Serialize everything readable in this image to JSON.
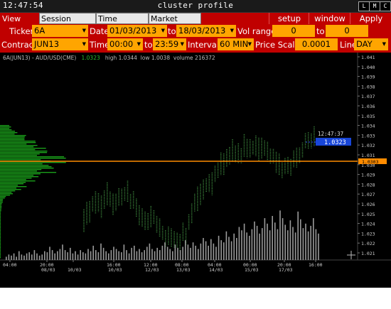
{
  "window": {
    "clock": "12:47:54",
    "title": "cluster profile",
    "buttons": [
      "L",
      "M",
      "C"
    ]
  },
  "menu": {
    "tabs": [
      "View DOM",
      "Session Hours",
      "Time Interval",
      "Market Watch"
    ],
    "active_tab": "View DOM",
    "right_buttons": [
      "setup",
      "window",
      "Apply"
    ]
  },
  "params": {
    "ticker_label": "Ticker",
    "ticker": "6A",
    "date_label": "Date",
    "date_from": "01/03/2013",
    "date_to_label": "to",
    "date_to": "18/03/2013",
    "vol_range_label": "Vol range",
    "vol_from": "0",
    "vol_to_label": "to",
    "vol_to": "0",
    "contract_label": "Contract",
    "contract": "JUN13",
    "time_label": "Time",
    "time_from": "00:00",
    "time_to_label": "to",
    "time_to": "23:59",
    "interval_label": "Interval",
    "interval": "60 MIN",
    "price_scale_label": "Price Scale",
    "price_scale": "0.0001",
    "line_label": "Line",
    "line": "DAY"
  },
  "chart": {
    "symbol": "6A(JUN13) - AUD/USD(CME)",
    "last": "1.0323",
    "high_text": "high 1.0344",
    "low_text": "low 1.0038",
    "volume_text": "volume 216372",
    "cursor_time": "12:47:37",
    "cursor_price": "1.0323",
    "line_price": "1.0303",
    "colors": {
      "grid": "#2a2a2a",
      "candles": "#3e8a3e",
      "profile": "#1a9e1a",
      "volume": "#9a9a9a",
      "line": "#ff8c00",
      "price_tag": "#1846d8"
    }
  },
  "chart_data": {
    "type": "bar",
    "y_ticks": [
      "1.041",
      "1.040",
      "1.039",
      "1.038",
      "1.037",
      "1.036",
      "1.035",
      "1.034",
      "1.033",
      "1.032",
      "1.031",
      "1.030",
      "1.029",
      "1.028",
      "1.027",
      "1.026",
      "1.025",
      "1.024",
      "1.023",
      "1.022",
      "1.021"
    ],
    "x_ticks": [
      {
        "time": "04:00",
        "date": ""
      },
      {
        "time": "20:00",
        "date": "08/03"
      },
      {
        "time": "",
        "date": "10/03"
      },
      {
        "time": "16:00",
        "date": "10/03"
      },
      {
        "time": "12:00",
        "date": "12/03"
      },
      {
        "time": "08:00",
        "date": "13/03"
      },
      {
        "time": "04:00",
        "date": "14/03"
      },
      {
        "time": "00:00",
        "date": "15/03"
      },
      {
        "time": "20:00",
        "date": "17/03"
      },
      {
        "time": "16:00",
        "date": ""
      }
    ],
    "volume_series": [
      3,
      5,
      4,
      6,
      3,
      8,
      5,
      4,
      6,
      7,
      5,
      9,
      6,
      4,
      5,
      8,
      7,
      12,
      9,
      6,
      8,
      10,
      14,
      9,
      7,
      11,
      6,
      8,
      5,
      9,
      7,
      6,
      10,
      8,
      13,
      9,
      7,
      15,
      11,
      8,
      6,
      9,
      12,
      10,
      8,
      7,
      14,
      9,
      6,
      11,
      13,
      8,
      10,
      7,
      9,
      12,
      15,
      10,
      8,
      11,
      9,
      13,
      16,
      12,
      10,
      8,
      14,
      11,
      9,
      12,
      18,
      14,
      11,
      16,
      13,
      10,
      15,
      20,
      17,
      13,
      19,
      15,
      12,
      22,
      18,
      16,
      26,
      21,
      17,
      24,
      20,
      30,
      27,
      33,
      25,
      22,
      28,
      35,
      31,
      24,
      29,
      38,
      33,
      27,
      40,
      34,
      28,
      45,
      38,
      32,
      27,
      36,
      30,
      25,
      44,
      37,
      29,
      33,
      26,
      31,
      38,
      28,
      24
    ]
  }
}
